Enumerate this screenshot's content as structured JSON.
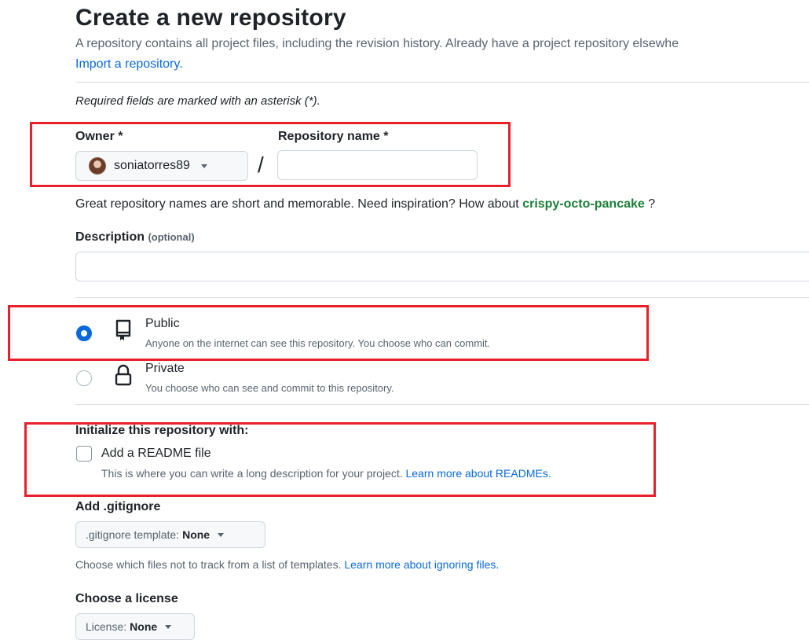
{
  "header": {
    "title": "Create a new repository",
    "intro": "A repository contains all project files, including the revision history. Already have a project repository elsewhe",
    "import_link": "Import a repository."
  },
  "required_note": "Required fields are marked with an asterisk (*).",
  "owner": {
    "label": "Owner *",
    "value": "soniatorres89"
  },
  "slash": "/",
  "repo_name": {
    "label": "Repository name *",
    "value": "",
    "placeholder": ""
  },
  "name_hint": {
    "text": "Great repository names are short and memorable. Need inspiration? How about",
    "suggestion": "crispy-octo-pancake",
    "suffix": "?"
  },
  "description": {
    "label": "Description",
    "optional": "(optional)",
    "value": ""
  },
  "visibility": {
    "selected": "Public",
    "options": [
      {
        "title": "Public",
        "description": "Anyone on the internet can see this repository. You choose who can commit.",
        "icon": "repo-icon"
      },
      {
        "title": "Private",
        "description": "You choose who can see and commit to this repository.",
        "icon": "lock-icon"
      }
    ]
  },
  "initialize": {
    "label": "Initialize this repository with:",
    "readme_label": "Add a README file",
    "readme_checked": false,
    "readme_desc": "This is where you can write a long description for your project.",
    "readme_link": "Learn more about READMEs."
  },
  "gitignore": {
    "label": "Add .gitignore",
    "button_prefix": ".gitignore template:",
    "button_value": "None",
    "hint": "Choose which files not to track from a list of templates.",
    "hint_link": "Learn more about ignoring files."
  },
  "license": {
    "label": "Choose a license",
    "button_prefix": "License:",
    "button_value": "None"
  },
  "colors": {
    "link": "#0969da",
    "suggestion": "#1a7f37",
    "highlight_box": "#e8202a",
    "radio_selected": "#0969da"
  }
}
